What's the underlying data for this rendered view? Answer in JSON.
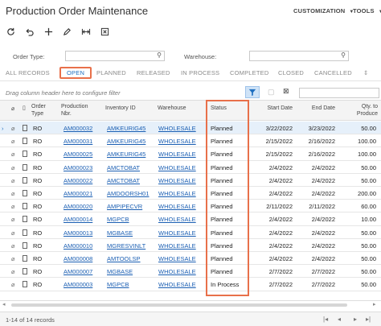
{
  "header": {
    "title": "Production Order Maintenance",
    "customization": "CUSTOMIZATION",
    "tools": "TOOLS"
  },
  "toolbar": {
    "icons": [
      "refresh-icon",
      "undo-icon",
      "add-icon",
      "edit-icon",
      "fit-columns-icon",
      "export-excel-icon"
    ]
  },
  "filters": {
    "order_type_label": "Order Type:",
    "order_type_value": "",
    "warehouse_label": "Warehouse:",
    "warehouse_value": ""
  },
  "tabs": [
    "ALL RECORDS",
    "OPEN",
    "PLANNED",
    "RELEASED",
    "IN PROCESS",
    "COMPLETED",
    "CLOSED",
    "CANCELLED"
  ],
  "active_tab": "OPEN",
  "grid": {
    "drag_hint": "Drag column header here to configure filter",
    "search_value": "",
    "columns": {
      "order_type": "Order Type",
      "production_nbr": "Production Nbr.",
      "inventory_id": "Inventory ID",
      "warehouse": "Warehouse",
      "status": "Status",
      "start_date": "Start Date",
      "end_date": "End Date",
      "qty_to_produce": "Qty. to Produce"
    },
    "rows": [
      {
        "type": "RO",
        "nbr": "AM000032",
        "inv": "AMKEURIG45",
        "wh": "WHOLESALE",
        "status": "Planned",
        "start": "3/22/2022",
        "end": "3/23/2022",
        "qty": "50.00"
      },
      {
        "type": "RO",
        "nbr": "AM000031",
        "inv": "AMKEURIG45",
        "wh": "WHOLESALE",
        "status": "Planned",
        "start": "2/15/2022",
        "end": "2/16/2022",
        "qty": "100.00"
      },
      {
        "type": "RO",
        "nbr": "AM000025",
        "inv": "AMKEURIG45",
        "wh": "WHOLESALE",
        "status": "Planned",
        "start": "2/15/2022",
        "end": "2/16/2022",
        "qty": "100.00"
      },
      {
        "type": "RO",
        "nbr": "AM000023",
        "inv": "AMCTOBAT",
        "wh": "WHOLESALE",
        "status": "Planned",
        "start": "2/4/2022",
        "end": "2/4/2022",
        "qty": "50.00"
      },
      {
        "type": "RO",
        "nbr": "AM000022",
        "inv": "AMCTOBAT",
        "wh": "WHOLESALE",
        "status": "Planned",
        "start": "2/4/2022",
        "end": "2/4/2022",
        "qty": "50.00"
      },
      {
        "type": "RO",
        "nbr": "AM000021",
        "inv": "AMDOORSH01",
        "wh": "WHOLESALE",
        "status": "Planned",
        "start": "2/4/2022",
        "end": "2/4/2022",
        "qty": "200.00"
      },
      {
        "type": "RO",
        "nbr": "AM000020",
        "inv": "AMPIPECVR",
        "wh": "WHOLESALE",
        "status": "Planned",
        "start": "2/11/2022",
        "end": "2/11/2022",
        "qty": "60.00"
      },
      {
        "type": "RO",
        "nbr": "AM000014",
        "inv": "MGPCB",
        "wh": "WHOLESALE",
        "status": "Planned",
        "start": "2/4/2022",
        "end": "2/4/2022",
        "qty": "10.00"
      },
      {
        "type": "RO",
        "nbr": "AM000013",
        "inv": "MGBASE",
        "wh": "WHOLESALE",
        "status": "Planned",
        "start": "2/4/2022",
        "end": "2/4/2022",
        "qty": "50.00"
      },
      {
        "type": "RO",
        "nbr": "AM000010",
        "inv": "MGRESVINLT",
        "wh": "WHOLESALE",
        "status": "Planned",
        "start": "2/4/2022",
        "end": "2/4/2022",
        "qty": "50.00"
      },
      {
        "type": "RO",
        "nbr": "AM000008",
        "inv": "AMTOOLSP",
        "wh": "WHOLESALE",
        "status": "Planned",
        "start": "2/4/2022",
        "end": "2/4/2022",
        "qty": "50.00"
      },
      {
        "type": "RO",
        "nbr": "AM000007",
        "inv": "MGBASE",
        "wh": "WHOLESALE",
        "status": "Planned",
        "start": "2/7/2022",
        "end": "2/7/2022",
        "qty": "50.00"
      },
      {
        "type": "RO",
        "nbr": "AM000003",
        "inv": "MGPCB",
        "wh": "WHOLESALE",
        "status": "In Process",
        "start": "2/7/2022",
        "end": "2/7/2022",
        "qty": "50.00"
      }
    ]
  },
  "footer": {
    "record_count": "1-14 of 14 records"
  },
  "colors": {
    "highlight": "#e8704a",
    "link": "#1b5fb3",
    "selected_row": "#e6f0fa"
  }
}
